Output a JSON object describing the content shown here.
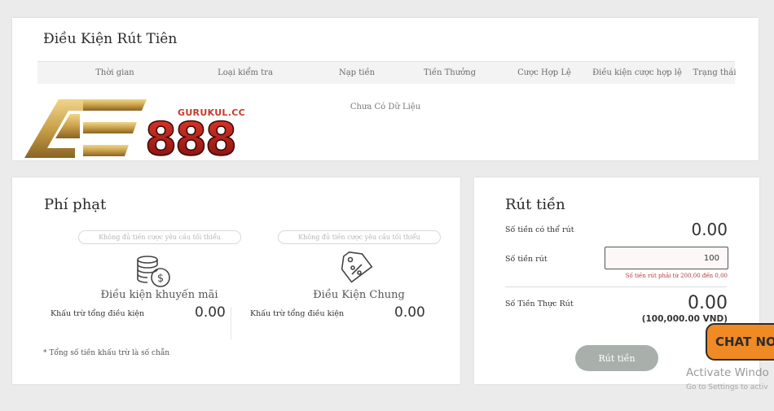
{
  "top_card": {
    "title": "Điều Kiện Rút Tiên",
    "columns": [
      "Thời gian",
      "Loại kiểm tra",
      "Nạp tiền",
      "Tiền Thưởng",
      "Cược Hợp Lệ",
      "Điều kiện cược hợp lệ",
      "Trạng thái"
    ],
    "empty_text": "Chưa Có Dữ Liệu"
  },
  "logo": {
    "site": "GURUKUL.CC",
    "brand": "AE888",
    "brand_colors": {
      "gold": "#c9a14a",
      "red": "#a81515"
    }
  },
  "fine_card": {
    "title": "Phí phạt",
    "boxes": [
      {
        "pill": "Không đủ tiền cược yêu cầu tối thiểu",
        "icon": "coins-dollar-icon",
        "label": "Điều kiện khuyến mãi",
        "sub_label": "Khấu trừ tổng điều kiện",
        "value": "0.00"
      },
      {
        "pill": "Không đủ tiền cược yêu cầu tối thiểu",
        "icon": "discount-tag-icon",
        "label": "Điều Kiện Chung",
        "sub_label": "Khấu trừ tổng điều kiện",
        "value": "0.00"
      }
    ],
    "note": "* Tổng số tiền khấu trừ là số chẵn"
  },
  "withdraw_card": {
    "title": "Rút tiền",
    "available_label": "Số tiền có thể rút",
    "available_value": "0.00",
    "amount_label": "Số tiền rút",
    "amount_value": "100",
    "amount_hint": "Số tiền rút phải từ 200,00 đến 0,00",
    "actual_label": "Số Tiền Thực Rút",
    "actual_value": "0.00",
    "actual_vnd": "(100,000.00 VND)",
    "button_label": "Rút tiền"
  },
  "overlay": {
    "chat_label": "CHAT NO",
    "activate_line1": "Activate Windo",
    "activate_line2": "Go to Settings to activ",
    "chat_color": "#f08a24"
  }
}
